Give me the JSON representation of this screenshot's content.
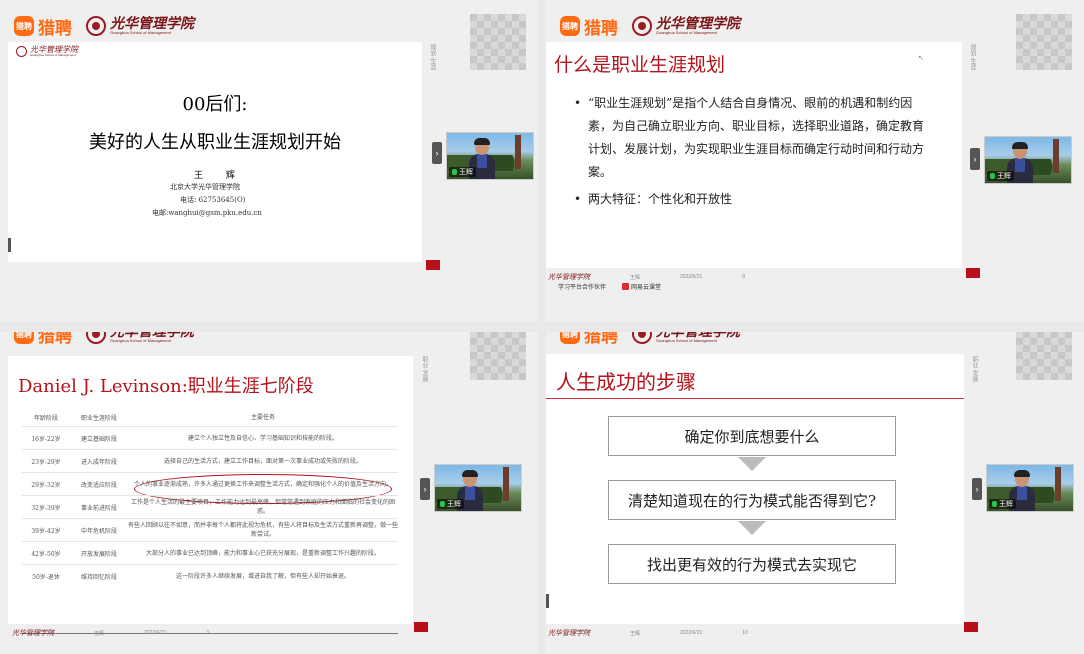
{
  "brand": {
    "liepin_icon": "猎聘",
    "liepin": "猎聘",
    "gsm_cn": "光华管理学院",
    "gsm_en": "Guanghua School of Management"
  },
  "slide1": {
    "logo_cn": "光华管理学院",
    "title_line1": "00后们:",
    "title_line2": "美好的人生从职业生涯规划开始",
    "name": "王 辉",
    "affiliation": "北京大学光华管理学院",
    "phone": "电话: 62753645(O)",
    "email": "电邮:wanghui@gsm.pku.edu.cn"
  },
  "slide2": {
    "title": "什么是职业生涯规划",
    "bullet1": "“职业生涯规划”是指个人结合自身情况、眼前的机遇和制约因素，为自己确立职业方向、职业目标，选择职业道路，确定教育计划、发展计划，为实现职业生涯目标而确定行动时间和行动方案。",
    "bullet2": "两大特征：个性化和开放性",
    "footer_presenter": "王辉",
    "footer_date": "2022/6/21",
    "footer_page": "9"
  },
  "below_slide2": {
    "partner": "学习平台合作伙伴",
    "platform": "网易云课堂"
  },
  "slide3": {
    "title": "Daniel J. Levinson:职业生涯七阶段",
    "headers": [
      "年龄阶段",
      "职业生涯阶段",
      "主要任务"
    ],
    "rows": [
      [
        "16岁-22岁",
        "建立基础阶段",
        "建立个人独立性及自信心、学习基础知识和技能的阶段。"
      ],
      [
        "23岁-29岁",
        "进入成年阶段",
        "选择自己的生活方式，建立工作目标，面对第一次事业成功或失败的阶段。"
      ],
      [
        "29岁-32岁",
        "改变适应阶段",
        "个人的事业逐渐成熟，许多人通过更换工作来调整生活方式，确定和强化个人的价值及生活方向。"
      ],
      [
        "32岁-39岁",
        "事业前进阶段",
        "工作是个人生活的最主要项目，工作能力达到最高峰，但常常遇到家庭的压力和面临的社会变化的困惑。"
      ],
      [
        "39岁-42岁",
        "中年危机阶段",
        "有些人回顾以往不如意，而并非每个人都将此视为危机，有些人将目标及生活方式重新再调整，做一些新尝试。"
      ],
      [
        "42岁-50岁",
        "开放发展阶段",
        "大部分人的事业已达到顶峰，能力和事业心已获充分展现，是重新调整工作兴趣的阶段。"
      ],
      [
        "50岁-退休",
        "维持回忆阶段",
        "这一阶段许多人继续发展，增进自我了解，但有些人却开始衰退。"
      ]
    ],
    "footer_presenter": "王辉",
    "footer_date": "2022/6/21",
    "footer_page": "3"
  },
  "slide4": {
    "title": "人生成功的步骤",
    "step1": "确定你到底想要什么",
    "step2": "清楚知道现在的行为模式能否得到它?",
    "step3": "找出更有效的行为模式去实现它",
    "footer_presenter": "王辉",
    "footer_date": "2022/6/21",
    "footer_page": "10"
  },
  "side_labels": {
    "a": "规划·生涯",
    "b": "职业·发展"
  },
  "video": {
    "participant_name": "王辉"
  },
  "colors": {
    "accent_red": "#b5121b",
    "liepin_orange": "#ff6a13"
  }
}
